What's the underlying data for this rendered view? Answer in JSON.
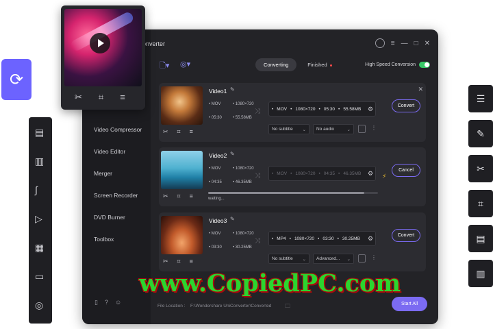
{
  "app": {
    "title_fragment": "onverter"
  },
  "toolbar": {
    "tab_converting": "Converting",
    "tab_finished": "Finished",
    "high_speed_label": "High Speed Conversion",
    "high_speed_on": true
  },
  "sidebar": {
    "items": [
      {
        "label": "Video Compressor"
      },
      {
        "label": "Video Editor"
      },
      {
        "label": "Merger"
      },
      {
        "label": "Screen Recorder"
      },
      {
        "label": "DVD Burner"
      },
      {
        "label": "Toolbox"
      }
    ]
  },
  "cards": [
    {
      "name": "Video1",
      "src_format": "MOV",
      "src_res": "1080×720",
      "src_duration": "05:30",
      "src_size": "55.58MB",
      "dst_format": "MOV",
      "dst_res": "1080×720",
      "dst_duration": "05:30",
      "dst_size": "55.58MB",
      "subtitle": "No subtitle",
      "audio": "No audio",
      "action": "Convert"
    },
    {
      "name": "Video2",
      "src_format": "MOV",
      "src_res": "1080×720",
      "src_duration": "04:35",
      "src_size": "46.35MB",
      "dst_format": "MOV",
      "dst_res": "1080×720",
      "dst_duration": "04:35",
      "dst_size": "46.35MB",
      "status": "waiting...",
      "action": "Cancel",
      "progress": 0.92
    },
    {
      "name": "Video3",
      "src_format": "MOV",
      "src_res": "1080×720",
      "src_duration": "03:30",
      "src_size": "30.25MB",
      "dst_format": "MP4",
      "dst_res": "1080×720",
      "dst_duration": "03:30",
      "dst_size": "30.25MB",
      "subtitle": "No subtitle",
      "audio": "Advanced...",
      "action": "Convert"
    }
  ],
  "bottom": {
    "file_location_label": "File Location :",
    "file_path": "F:\\Wondershare UniConverter\\Converted",
    "start_all": "Start All"
  },
  "watermark": "www.CopiedPC.com",
  "colors": {
    "accent": "#7b6bf2",
    "toggle_on": "#37c866",
    "watermark_green": "#2bd52f",
    "watermark_outline": "#a80b0b",
    "panel": "#232327"
  },
  "icons": {
    "preview_actions": [
      "scissors-icon",
      "crop-icon",
      "menu-icon"
    ],
    "left_badge": "refresh-icon",
    "right_tools": [
      "settings-sliders-icon",
      "edit-doc-icon",
      "scissors-icon",
      "crop-icon",
      "document-icon",
      "audio-icon"
    ]
  }
}
